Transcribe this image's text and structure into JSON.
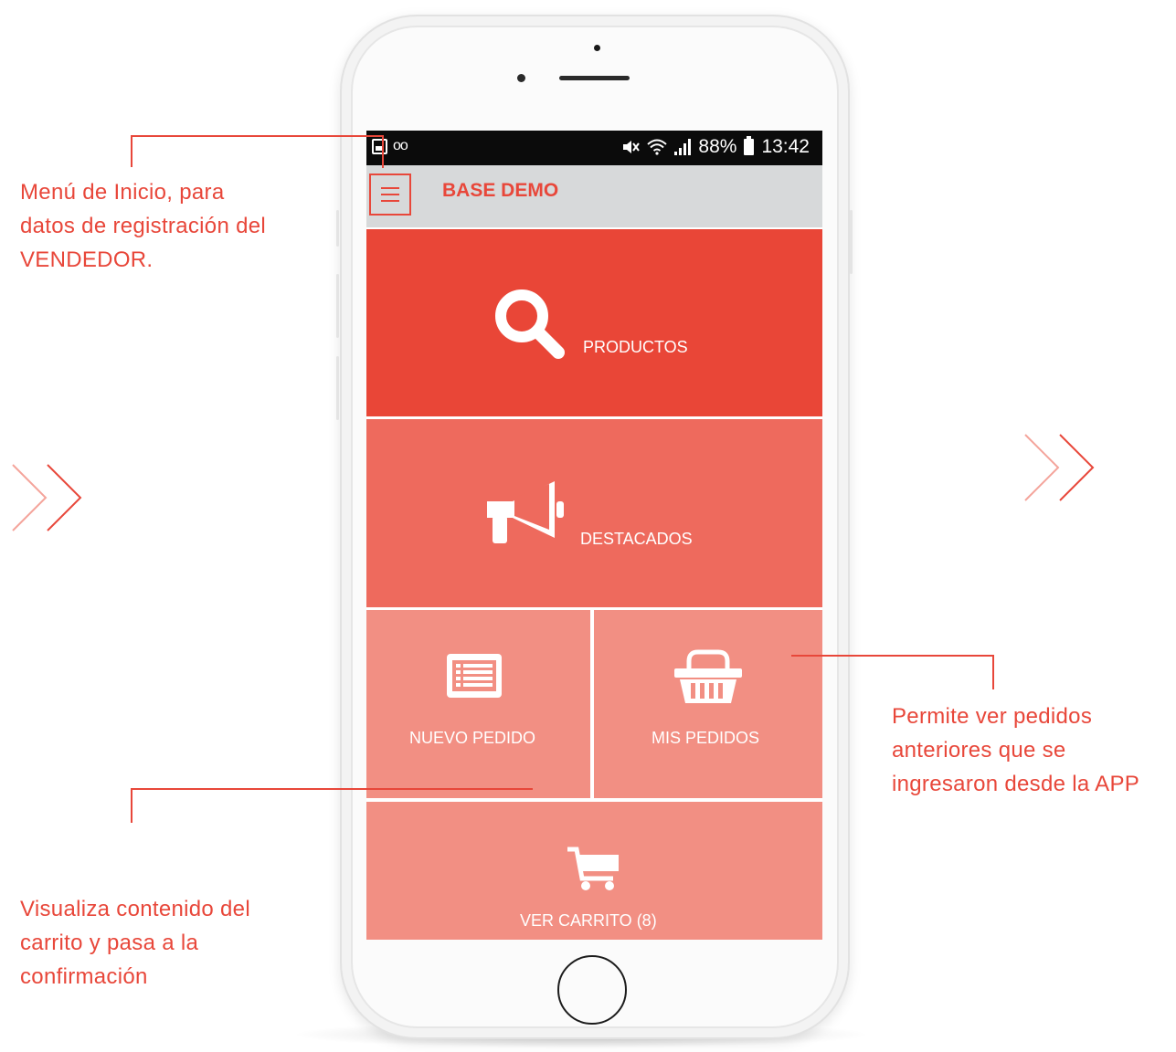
{
  "status_bar": {
    "voicemail_glyph": "oo",
    "battery_percent": "88%",
    "time": "13:42",
    "icons": [
      "image-icon",
      "mute-icon",
      "wifi-icon",
      "signal-icon",
      "battery-icon"
    ]
  },
  "app_bar": {
    "title": "BASE DEMO",
    "menu_icon": "hamburger-icon"
  },
  "tiles": {
    "productos": {
      "label": "PRODUCTOS",
      "icon": "search-icon"
    },
    "destacados": {
      "label": "DESTACADOS",
      "icon": "megaphone-icon"
    },
    "nuevo_pedido": {
      "label": "NUEVO PEDIDO",
      "icon": "list-icon"
    },
    "mis_pedidos": {
      "label": "MIS PEDIDOS",
      "icon": "basket-icon"
    },
    "ver_carrito": {
      "label": "VER CARRITO (8)",
      "icon": "cart-icon"
    }
  },
  "annotations": {
    "menu_note": [
      "Menú de Inicio, para",
      "datos de registración del",
      "VENDEDOR."
    ],
    "pedidos_note": [
      "Permite ver pedidos",
      "anteriores que se",
      "ingresaron desde la APP"
    ],
    "carrito_note": [
      "Visualiza contenido del",
      "carrito y pasa a la",
      "confirmación"
    ]
  },
  "colors": {
    "accent": "#e8473a",
    "tile_productos": "#e94637",
    "tile_destacados": "#ee6a5d",
    "tile_light": "#f28f83",
    "app_bar": "#d7d9da"
  }
}
